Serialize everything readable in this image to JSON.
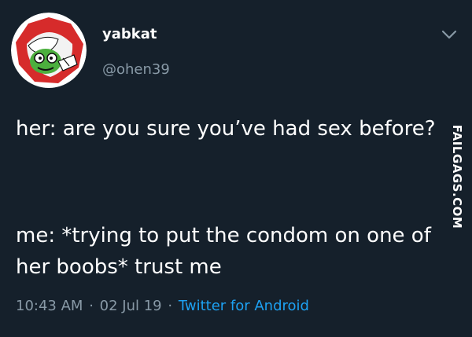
{
  "tweet": {
    "display_name": "yabkat",
    "handle": "@ohen39",
    "avatar_icon": "cartoon-avatar-icon",
    "menu_icon": "chevron-down-icon",
    "text_line_1": "her: are you sure you’ve had sex before?",
    "text_line_2": "me: *trying to put the condom on one of her boobs* trust me",
    "time": "10:43 AM",
    "date": "02 Jul 19",
    "separator": "·",
    "source": "Twitter for Android"
  },
  "watermark": {
    "text": "FAILGAGS.COM"
  },
  "colors": {
    "background": "#15202b",
    "primary_text": "#ffffff",
    "secondary_text": "#8899a6",
    "link": "#1da1f2"
  }
}
